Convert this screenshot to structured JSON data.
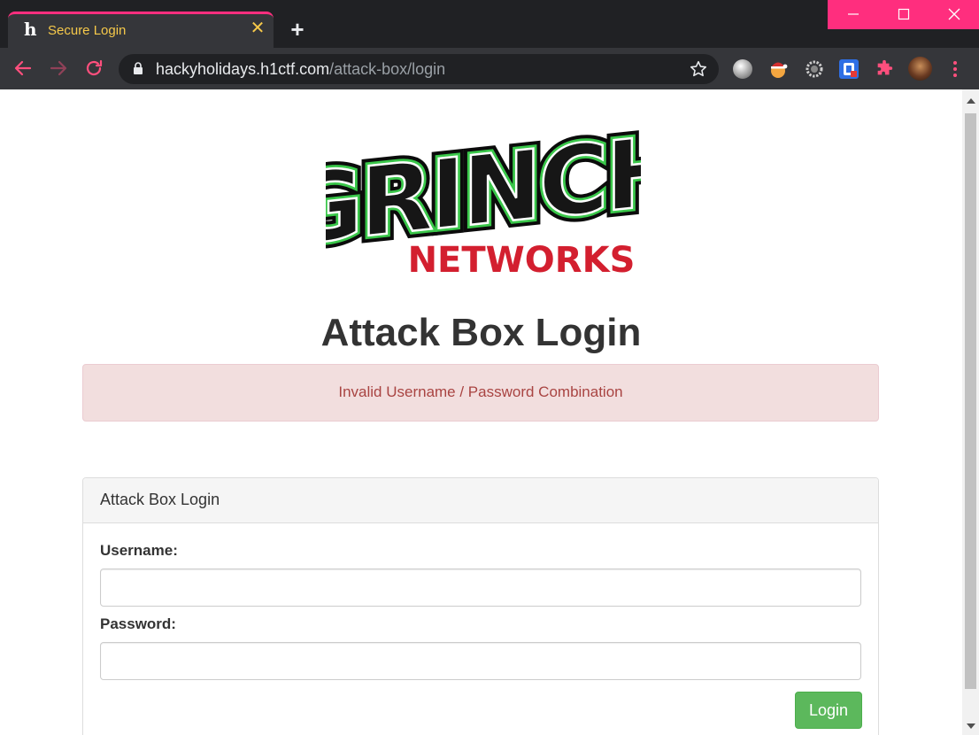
{
  "browser": {
    "tab_title": "Secure Login",
    "tab_favicon": "h",
    "tab_close": "✕",
    "new_tab": "+",
    "url_host": "hackyholidays.h1ctf.com",
    "url_path": "/attack-box/login",
    "accent_color": "#ff2e7e",
    "icons": [
      "back-icon",
      "forward-icon",
      "reload-icon",
      "lock-icon",
      "star-icon",
      "extension-globe-icon",
      "extension-santa-icon",
      "extension-gear-icon",
      "extension-shield-icon",
      "extensions-puzzle-icon",
      "profile-avatar",
      "menu-dots-icon"
    ]
  },
  "page": {
    "logo": {
      "top_text": "GRINCH",
      "bottom_text": "NETWORKS"
    },
    "heading": "Attack Box Login",
    "alert": "Invalid Username / Password Combination",
    "panel": {
      "title": "Attack Box Login",
      "username_label": "Username:",
      "username_value": "",
      "password_label": "Password:",
      "password_value": "",
      "login_button": "Login"
    }
  }
}
